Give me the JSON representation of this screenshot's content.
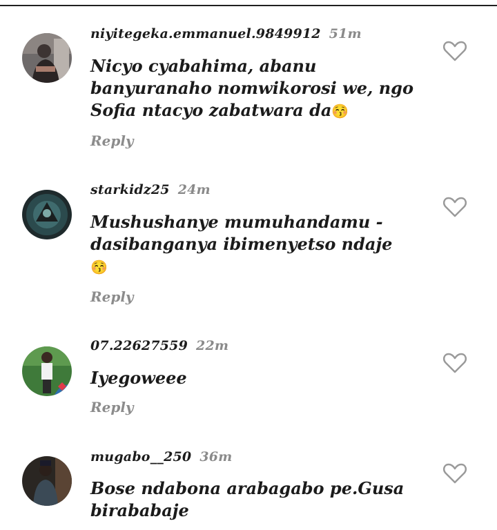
{
  "comments": [
    {
      "username": "niyitegeka.emmanuel.9849912",
      "time": "51m",
      "text": "Nicyo cyabahima, abanu banyuranaho nomwikorosi we, ngo Sofia ntacyo zabatwara da",
      "emoji": "😚",
      "reply": "Reply"
    },
    {
      "username": "starkidz25",
      "time": "24m",
      "text": "Mushushanye mumuhandamu - dasibanganya ibimenyetso ndaje",
      "emoji": "😚",
      "reply": "Reply"
    },
    {
      "username": "07.22627559",
      "time": "22m",
      "text": "Iyegoweee",
      "reply": "Reply"
    },
    {
      "username": "mugabo__250",
      "time": "36m",
      "text": "Bose ndabona arabagabo pe.Gusa birababaje"
    }
  ],
  "colors": {
    "username": "#1c1c1c",
    "time": "#8a8a8a",
    "reply": "#8c8c8c",
    "emoji": "#e040c8"
  }
}
